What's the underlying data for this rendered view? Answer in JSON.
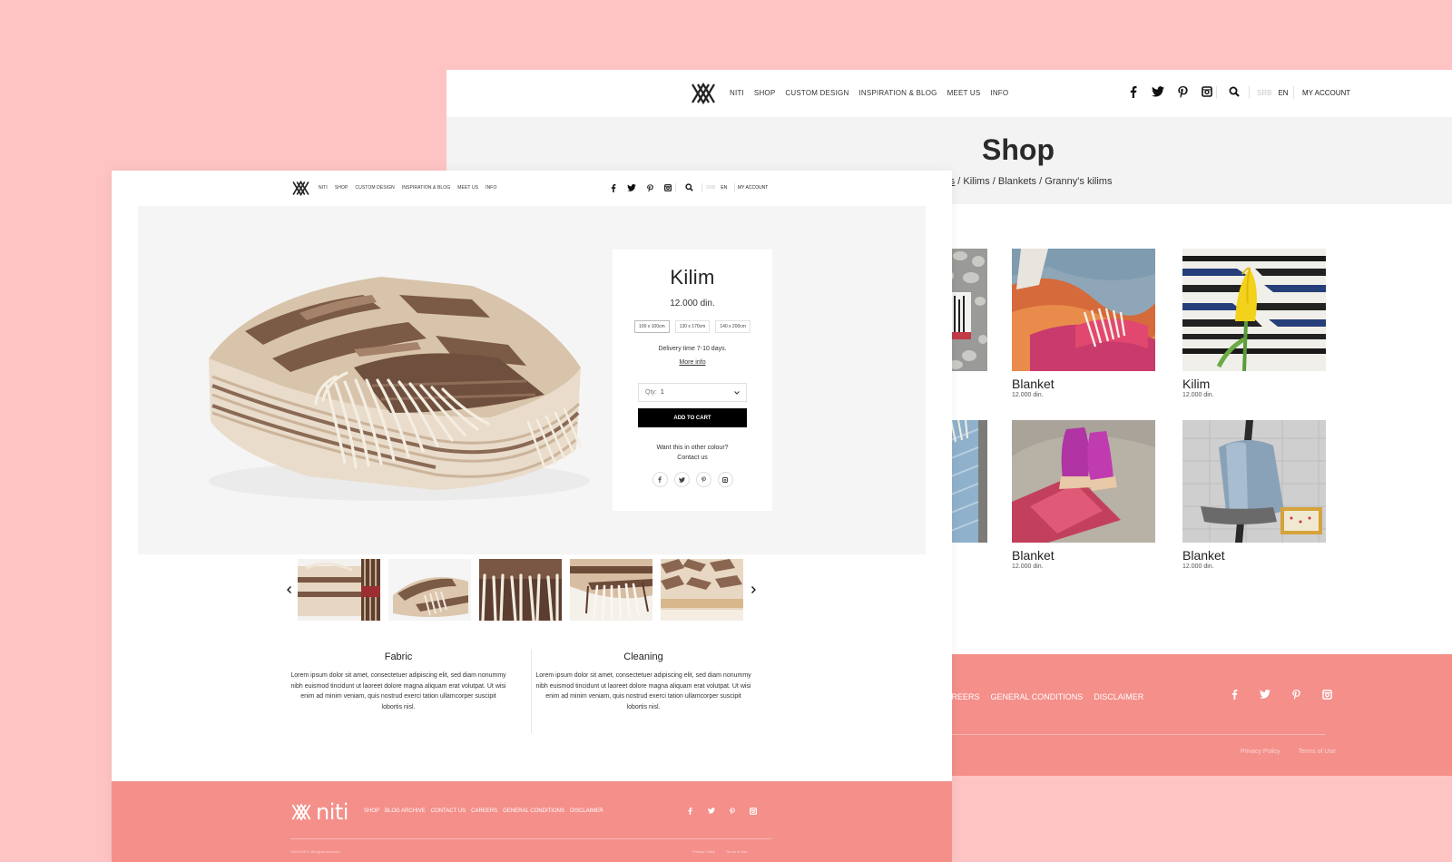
{
  "back": {
    "nav": {
      "menu": [
        "NITI",
        "SHOP",
        "CUSTOM DESIGN",
        "INSPIRATION & BLOG",
        "MEET US",
        "INFO"
      ],
      "lang_inactive": "SRB",
      "lang_active": "EN",
      "account": "MY ACCOUNT"
    },
    "hero": {
      "title": "Shop",
      "crumb_first": "ucts",
      "crumb_rest": " / Kilims / Blankets /  Granny's kilims"
    },
    "products": [
      {
        "name": "Blanket",
        "price": "12.000 din."
      },
      {
        "name": "Kilim",
        "price": "12.000 din."
      },
      {
        "name": "Blanket",
        "price": "12.000 din."
      },
      {
        "name": "Blanket",
        "price": "12.000 din."
      }
    ],
    "footer": {
      "links": [
        "CAREERS",
        "GENERAL CONDITIONS",
        "DISCLAIMER"
      ],
      "privacy": "Privacy Policy",
      "terms": "Terms of Use"
    }
  },
  "front": {
    "nav": {
      "menu": [
        "NITI",
        "SHOP",
        "CUSTOM DESIGN",
        "INSPIRATION & BLOG",
        "MEET US",
        "INFO"
      ],
      "lang_inactive": "SRB",
      "lang_active": "EN",
      "account": "MY ACCOUNT"
    },
    "product": {
      "title": "Kilim",
      "price": "12.000 din.",
      "sizes": [
        "100 x 100cm",
        "130 x 170cm",
        "140 x 200cm"
      ],
      "delivery": "Delivery time 7-10 days.",
      "more_info": "More info",
      "qty_label": "Qty:",
      "qty_value": "1",
      "add_to_cart": "ADD TO CART",
      "other_colour_line1": "Want this in other colour?",
      "other_colour_line2": "Contact us"
    },
    "info": {
      "fabric_title": "Fabric",
      "fabric_text": "Lorem ipsum dolor sit amet, consectetuer adipiscing elit, sed diam nonummy nibh euismod tincidunt ut laoreet dolore magna aliquam erat volutpat. Ut wisi enim ad minim veniam, quis nostrud exerci tation ullamcorper suscipit lobortis nisl.",
      "cleaning_title": "Cleaning",
      "cleaning_text": "Lorem ipsum dolor sit amet, consectetuer adipiscing elit, sed diam nonummy nibh euismod tincidunt ut laoreet dolore magna aliquam erat volutpat. Ut wisi enim ad minim veniam, quis nostrud exerci tation ullamcorper suscipit lobortis nisl."
    },
    "footer": {
      "brand": "niti",
      "links": [
        "SHOP",
        "BLOG ARCHIVE",
        "CONTACT US",
        "CAREERS",
        "GENERAL CONDITIONS",
        "DISCLAIMER"
      ],
      "copyright": "©2016 NITI. All rights reserved.",
      "privacy": "Privacy Policy",
      "terms": "Terms of Use"
    }
  },
  "colors": {
    "background": "#fdc4c3",
    "footer": "#f48f8a",
    "hero": "#f3f3f3"
  },
  "icons": [
    "niti-logo-icon",
    "facebook-icon",
    "twitter-icon",
    "pinterest-icon",
    "instagram-icon",
    "search-icon",
    "chevron-down-icon",
    "chevron-left-icon",
    "chevron-right-icon"
  ]
}
